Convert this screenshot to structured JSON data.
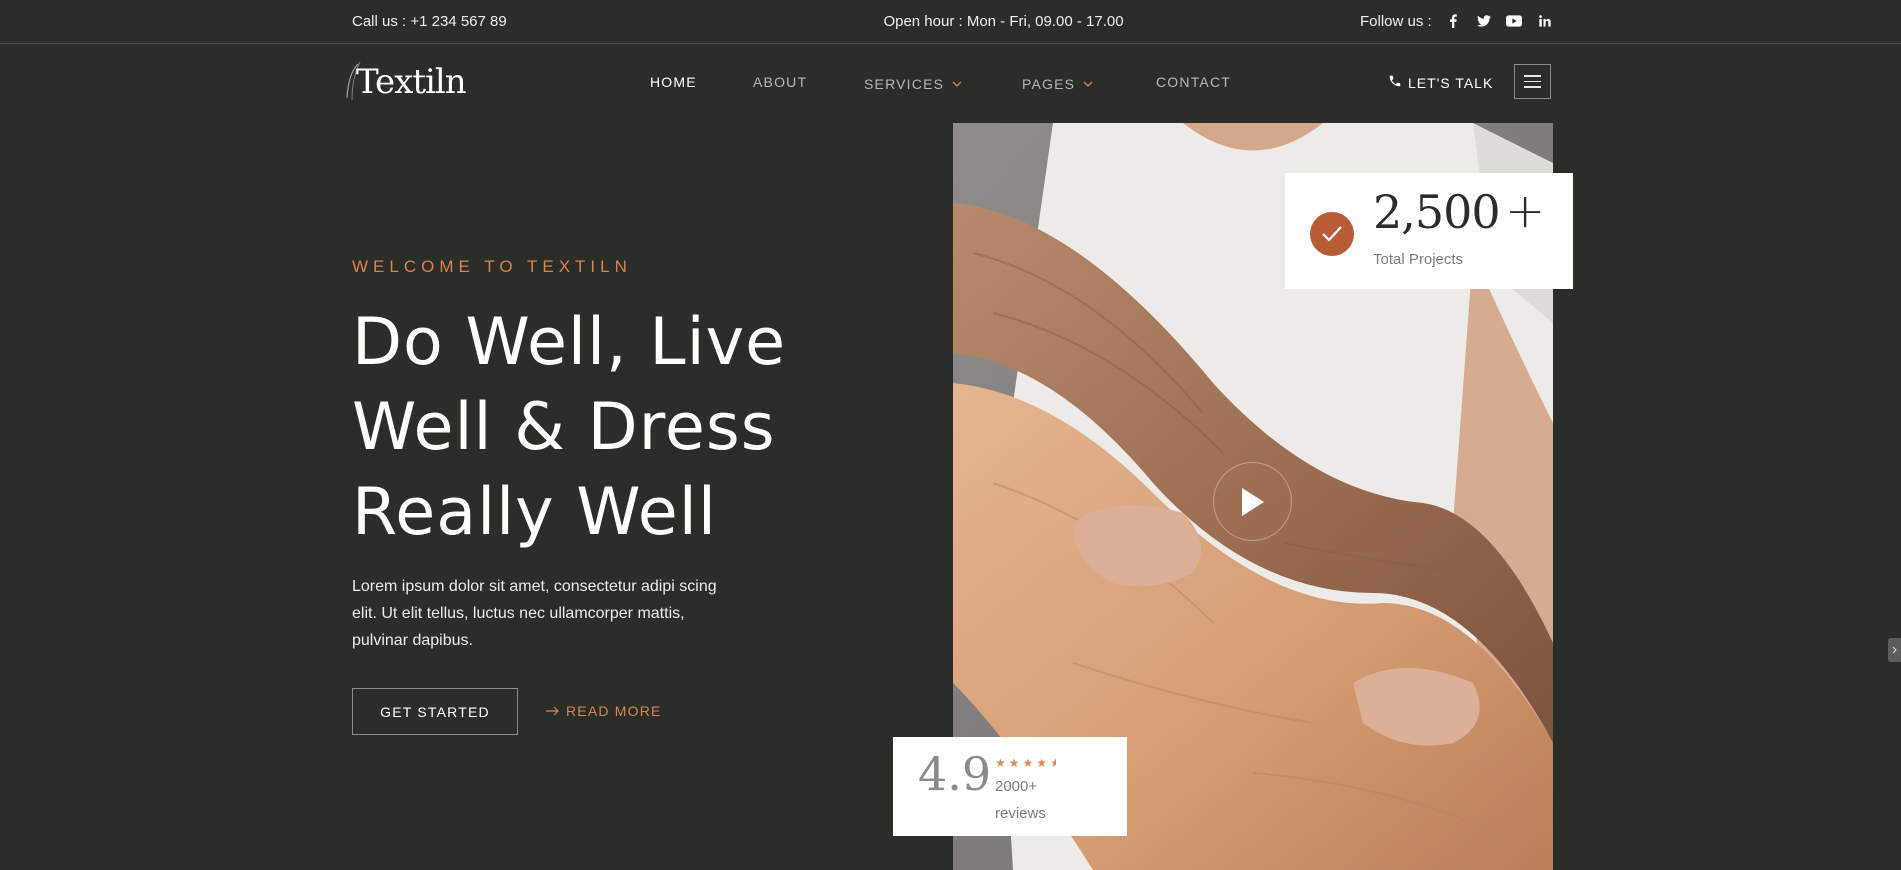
{
  "topbar": {
    "call": "Call us : +1 234 567 89",
    "hours": "Open hour : Mon - Fri, 09.00 - 17.00",
    "follow": "Follow us :",
    "socials": [
      "facebook-icon",
      "twitter-icon",
      "youtube-icon",
      "linkedin-icon"
    ]
  },
  "nav": {
    "logo": "Textiln",
    "items": [
      {
        "label": "HOME",
        "active": true
      },
      {
        "label": "ABOUT"
      },
      {
        "label": "SERVICES",
        "dropdown": true
      },
      {
        "label": "PAGES",
        "dropdown": true
      },
      {
        "label": "CONTACT"
      }
    ],
    "cta": "LET'S TALK"
  },
  "hero": {
    "eyebrow": "WELCOME TO TEXTILN",
    "title_lines": [
      "Do Well, Live",
      "Well & Dress",
      "Really Well"
    ],
    "description": "Lorem ipsum dolor sit amet, consectetur adipi scing elit. Ut elit tellus, luctus nec ullamcorper mattis, pulvinar dapibus.",
    "primary_button": "GET STARTED",
    "secondary_link": "READ MORE"
  },
  "stats": {
    "number": "2,500",
    "plus": "+",
    "label": "Total Projects"
  },
  "rating": {
    "value": "4.9",
    "stars": 4.5,
    "count": "2000+",
    "count_label": "reviews"
  },
  "colors": {
    "background": "#2a2d28",
    "accent": "#d9834f",
    "check": "#b85c35"
  }
}
